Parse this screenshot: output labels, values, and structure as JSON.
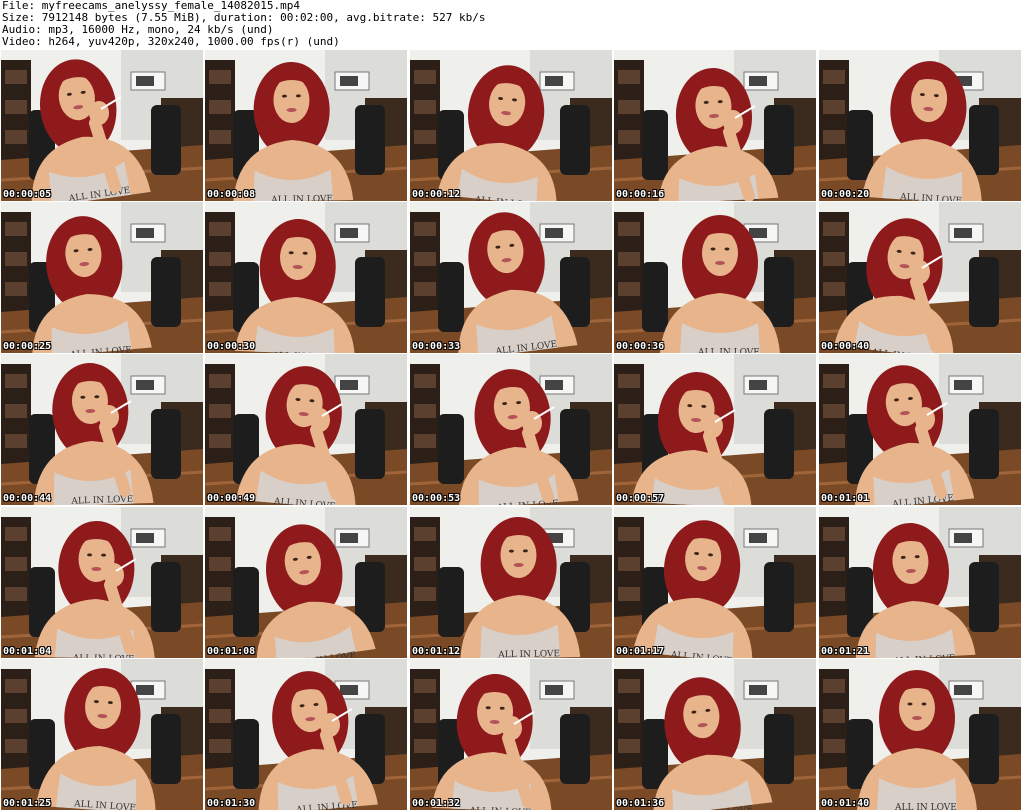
{
  "header": {
    "file": "File: myfreecams_anelyssy_female_14082015.mp4",
    "size": "Size: 7912148 bytes (7.55 MiB), duration: 00:02:00, avg.bitrate: 527 kb/s",
    "audio": "Audio: mp3, 16000 Hz, mono, 24 kb/s (und)",
    "video": "Video: h264, yuv420p, 320x240, 1000.00 fps(r) (und)"
  },
  "thumbnails": [
    {
      "timestamp": "00:00:05"
    },
    {
      "timestamp": "00:00:08"
    },
    {
      "timestamp": "00:00:12"
    },
    {
      "timestamp": "00:00:16"
    },
    {
      "timestamp": "00:00:20"
    },
    {
      "timestamp": "00:00:25"
    },
    {
      "timestamp": "00:00:30"
    },
    {
      "timestamp": "00:00:33"
    },
    {
      "timestamp": "00:00:36"
    },
    {
      "timestamp": "00:00:40"
    },
    {
      "timestamp": "00:00:44"
    },
    {
      "timestamp": "00:00:49"
    },
    {
      "timestamp": "00:00:53"
    },
    {
      "timestamp": "00:00:57"
    },
    {
      "timestamp": "00:01:01"
    },
    {
      "timestamp": "00:01:04"
    },
    {
      "timestamp": "00:01:08"
    },
    {
      "timestamp": "00:01:12"
    },
    {
      "timestamp": "00:01:17"
    },
    {
      "timestamp": "00:01:21"
    },
    {
      "timestamp": "00:01:25"
    },
    {
      "timestamp": "00:01:30"
    },
    {
      "timestamp": "00:01:32"
    },
    {
      "timestamp": "00:01:36"
    },
    {
      "timestamp": "00:01:40"
    }
  ],
  "colors": {
    "background": "#ffffff",
    "header_text": "#000000",
    "timestamp_text": "#ffffff",
    "hair": "#8e1a1c",
    "skin": "#e7b48c",
    "top": "#d8cfc8",
    "wall": "#efefec",
    "floor": "#7a4a26"
  }
}
